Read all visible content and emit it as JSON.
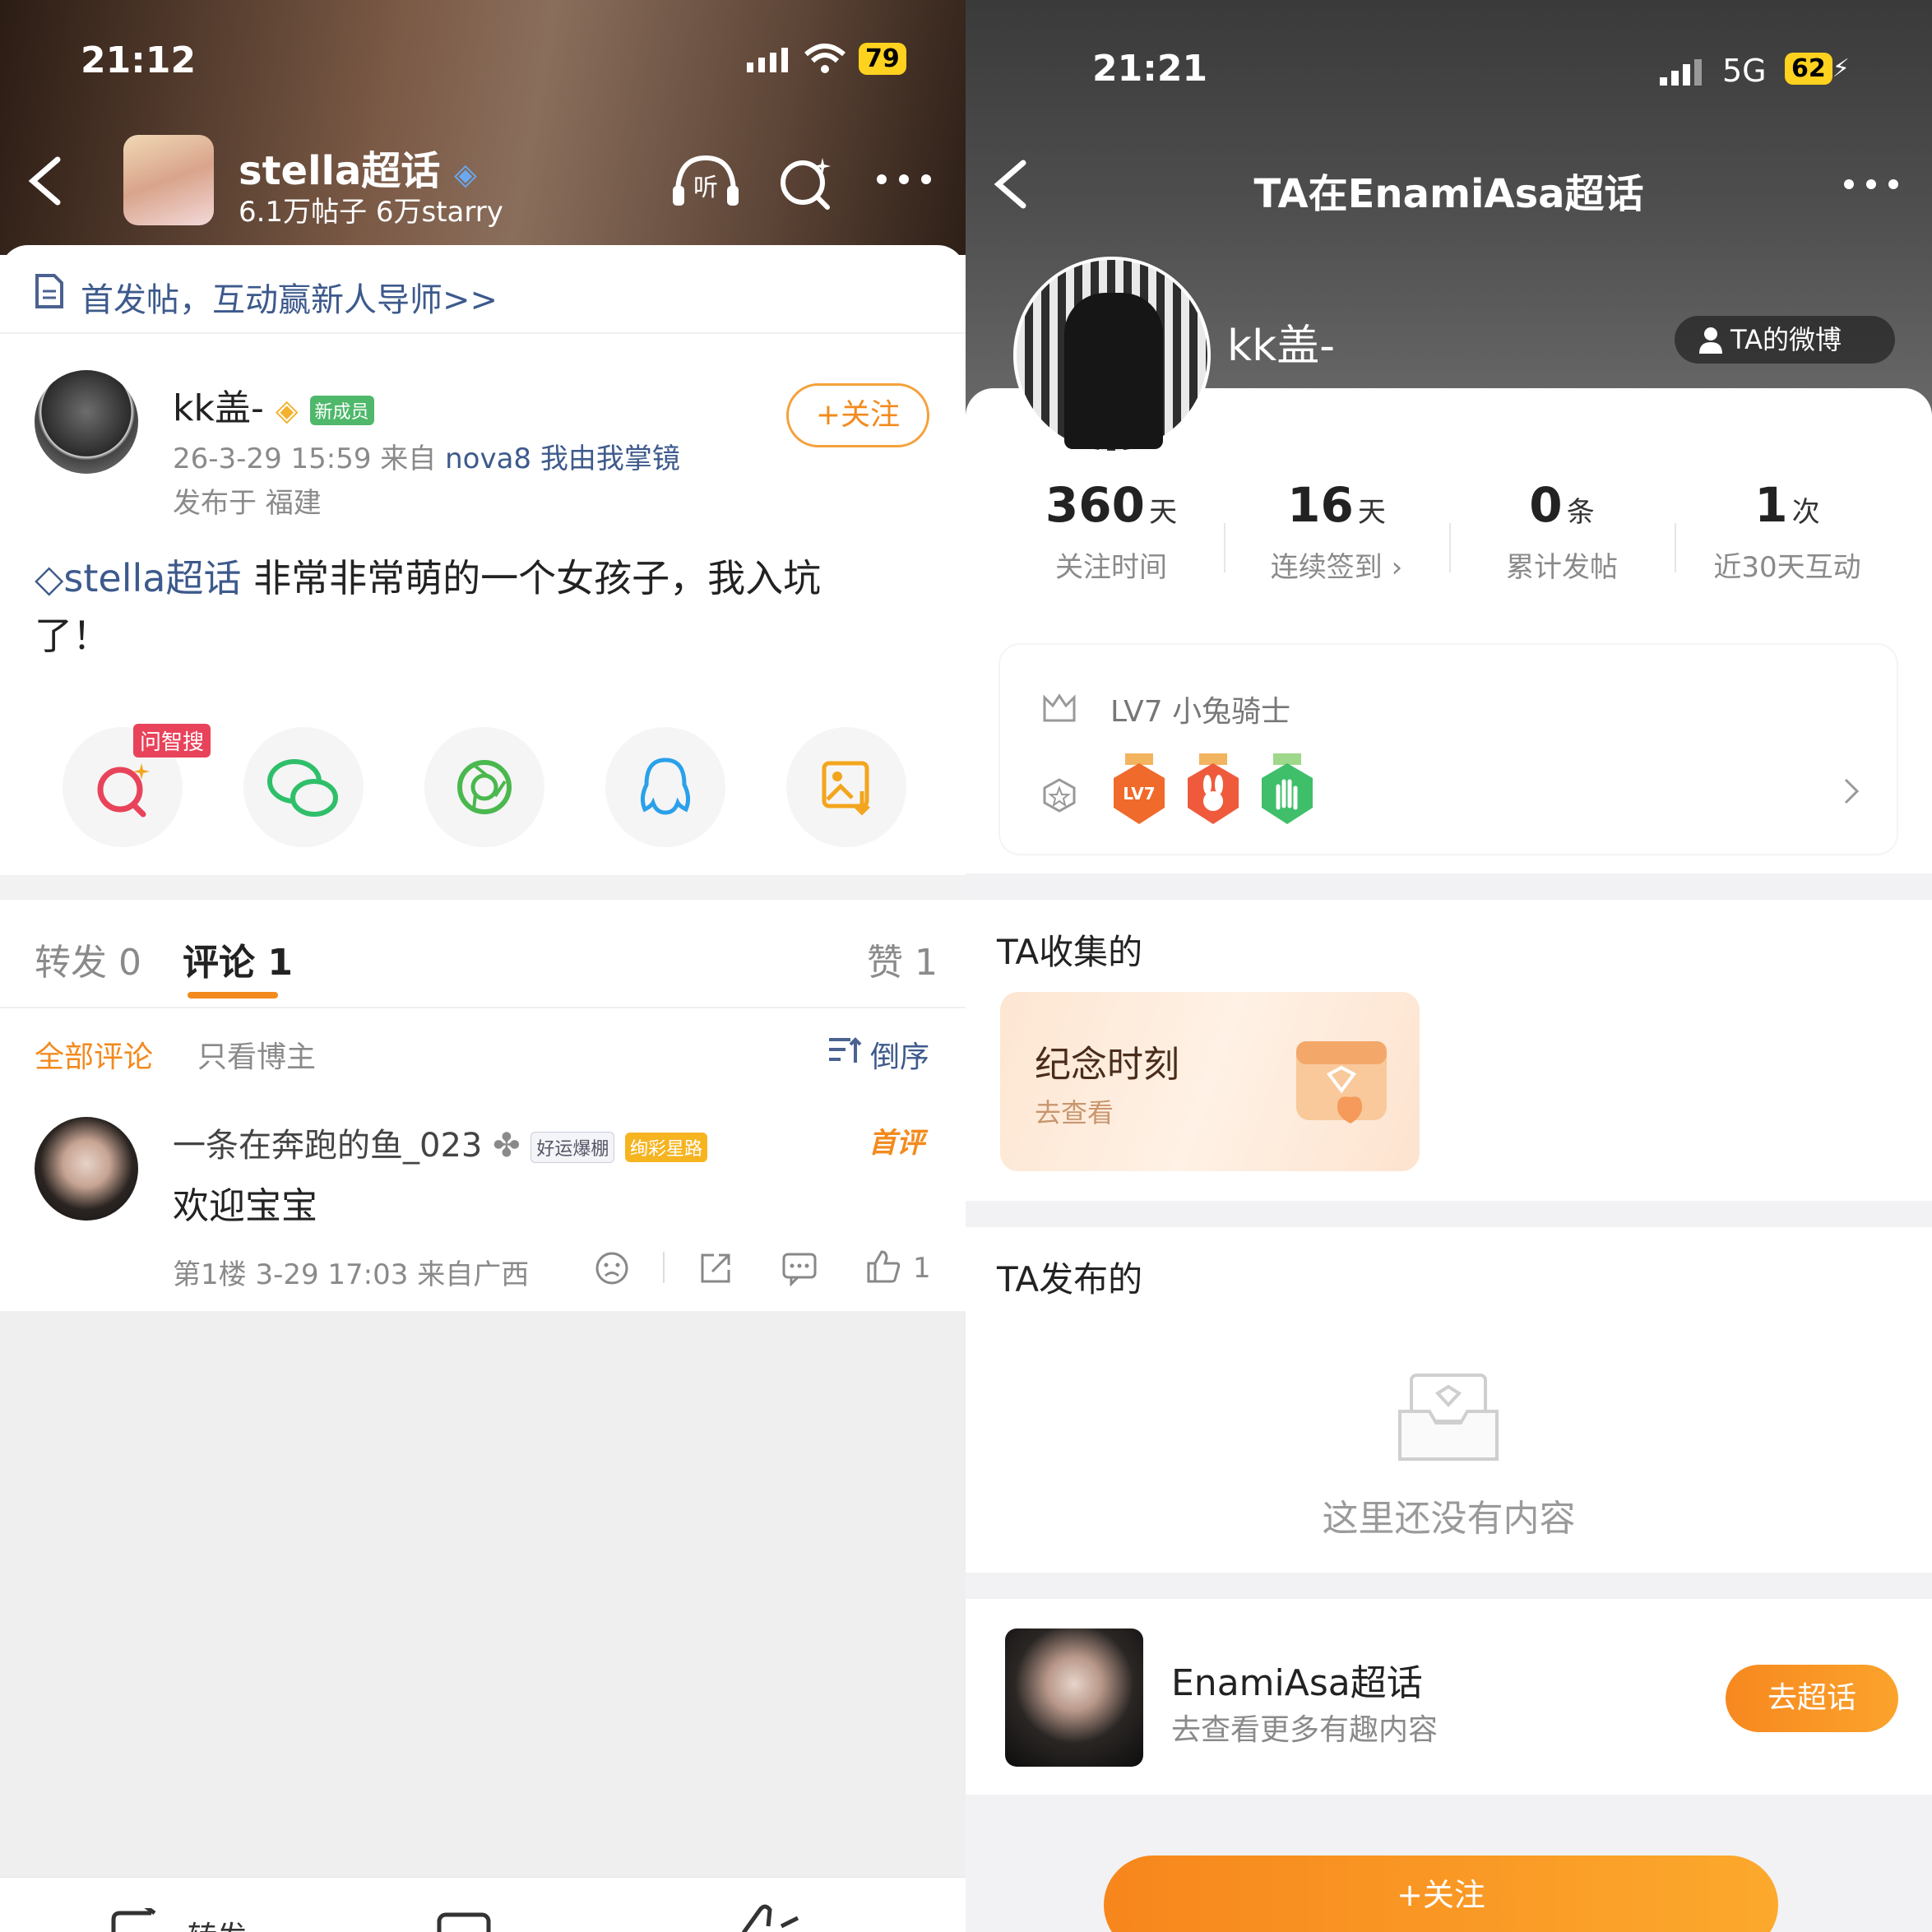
{
  "left": {
    "status": {
      "time": "21:12",
      "battery": "79"
    },
    "header": {
      "title": "stella超话",
      "subtitle": "6.1万帖子 6万starry"
    },
    "notice": "首发帖，互动赢新人导师>>",
    "post": {
      "username": "kk盖-",
      "new_badge": "新成员",
      "meta": "26-3-29 15:59  来自",
      "device": "nova8 我由我掌镜",
      "location": "发布于 福建",
      "follow_label": "+关注",
      "topic": "stella超话",
      "content_line1": "非常非常萌的一个女孩子，我入坑",
      "content_line2": "了！"
    },
    "share": {
      "search_tag": "问智搜"
    },
    "tabs": {
      "repost": "转发 0",
      "comment": "评论 1",
      "like": "赞 1"
    },
    "filters": {
      "all": "全部评论",
      "owner": "只看博主",
      "sort": "倒序"
    },
    "comment": {
      "username": "一条在奔跑的鱼_023",
      "badge1": "好运爆棚",
      "badge2": "绚彩星路",
      "first": "首评",
      "text": "欢迎宝宝",
      "meta": "第1楼  3-29 17:03  来自广西",
      "likes": "1"
    },
    "bottom": {
      "repost": "转发"
    }
  },
  "right": {
    "status": {
      "time": "21:21",
      "network": "5G",
      "battery": "62"
    },
    "header": {
      "title": "TA在EnamiAsa超话"
    },
    "profile": {
      "name": "kk盖-",
      "weibo_btn": "TA的微博"
    },
    "stats": [
      {
        "num": "360",
        "unit": "天",
        "label": "关注时间"
      },
      {
        "num": "16",
        "unit": "天",
        "label": "连续签到 ›"
      },
      {
        "num": "0",
        "unit": "条",
        "label": "累计发帖"
      },
      {
        "num": "1",
        "unit": "次",
        "label": "近30天互动"
      }
    ],
    "level": "LV7 小兔骑士",
    "medal_text": "LV7",
    "collected": {
      "title": "TA收集的",
      "card_title": "纪念时刻",
      "card_sub": "去查看"
    },
    "posted": {
      "title": "TA发布的",
      "empty": "这里还没有内容"
    },
    "topic": {
      "name": "EnamiAsa超话",
      "sub": "去查看更多有趣内容",
      "btn": "去超话"
    },
    "follow_btn": "+关注"
  }
}
